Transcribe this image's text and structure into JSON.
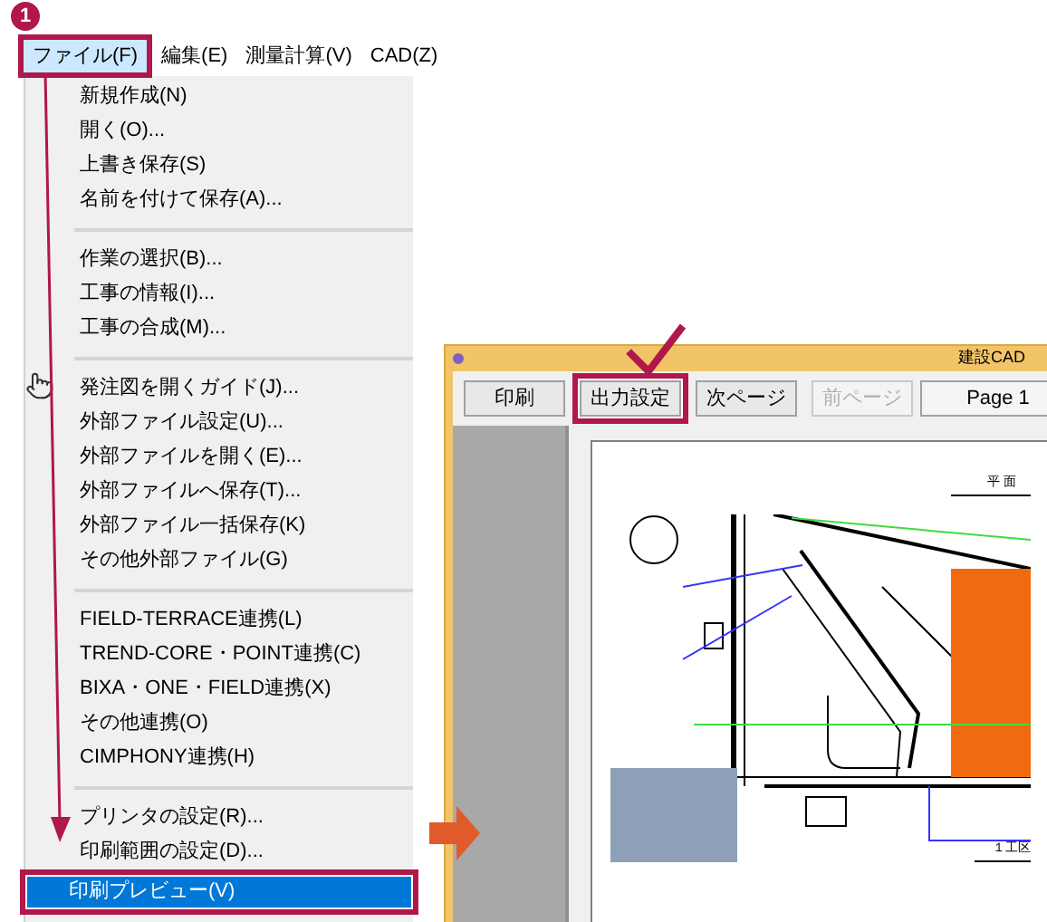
{
  "step_badge": "1",
  "menubar": [
    {
      "label": "ファイル(F)",
      "selected": true
    },
    {
      "label": "編集(E)",
      "selected": false
    },
    {
      "label": "測量計算(V)",
      "selected": false
    },
    {
      "label": "CAD(Z)",
      "selected": false
    }
  ],
  "menu": {
    "groups": [
      [
        {
          "label": "新規作成(N)",
          "selected": false
        },
        {
          "label": "開く(O)...",
          "selected": false
        },
        {
          "label": "上書き保存(S)",
          "selected": false
        },
        {
          "label": "名前を付けて保存(A)...",
          "selected": false
        }
      ],
      [
        {
          "label": "作業の選択(B)...",
          "selected": false
        },
        {
          "label": "工事の情報(I)...",
          "selected": false
        },
        {
          "label": "工事の合成(M)...",
          "selected": false
        }
      ],
      [
        {
          "label": "発注図を開くガイド(J)...",
          "selected": false
        },
        {
          "label": "外部ファイル設定(U)...",
          "selected": false
        },
        {
          "label": "外部ファイルを開く(E)...",
          "selected": false
        },
        {
          "label": "外部ファイルへ保存(T)...",
          "selected": false
        },
        {
          "label": "外部ファイル一括保存(K)",
          "selected": false
        },
        {
          "label": "その他外部ファイル(G)",
          "selected": false
        }
      ],
      [
        {
          "label": "FIELD-TERRACE連携(L)",
          "selected": false
        },
        {
          "label": "TREND-CORE・POINT連携(C)",
          "selected": false
        },
        {
          "label": "BIXA・ONE・FIELD連携(X)",
          "selected": false
        },
        {
          "label": "その他連携(O)",
          "selected": false
        },
        {
          "label": "CIMPHONY連携(H)",
          "selected": false
        }
      ],
      [
        {
          "label": "プリンタの設定(R)...",
          "selected": false
        },
        {
          "label": "印刷範囲の設定(D)...",
          "selected": false
        },
        {
          "label": "印刷プレビュー(V)",
          "selected": true
        }
      ]
    ]
  },
  "preview_window": {
    "title": "建設CAD",
    "toolbar": [
      {
        "kind": "button",
        "label": "印刷",
        "disabled": false,
        "highlighted": false
      },
      {
        "kind": "button",
        "label": "出力設定",
        "disabled": false,
        "highlighted": true
      },
      {
        "kind": "button",
        "label": "次ページ",
        "disabled": false,
        "highlighted": false
      },
      {
        "kind": "button",
        "label": "前ページ",
        "disabled": true,
        "highlighted": false
      },
      {
        "kind": "field",
        "label": "Page 1"
      }
    ],
    "sheet": {
      "title": "平 面",
      "caption": "１工区"
    }
  }
}
